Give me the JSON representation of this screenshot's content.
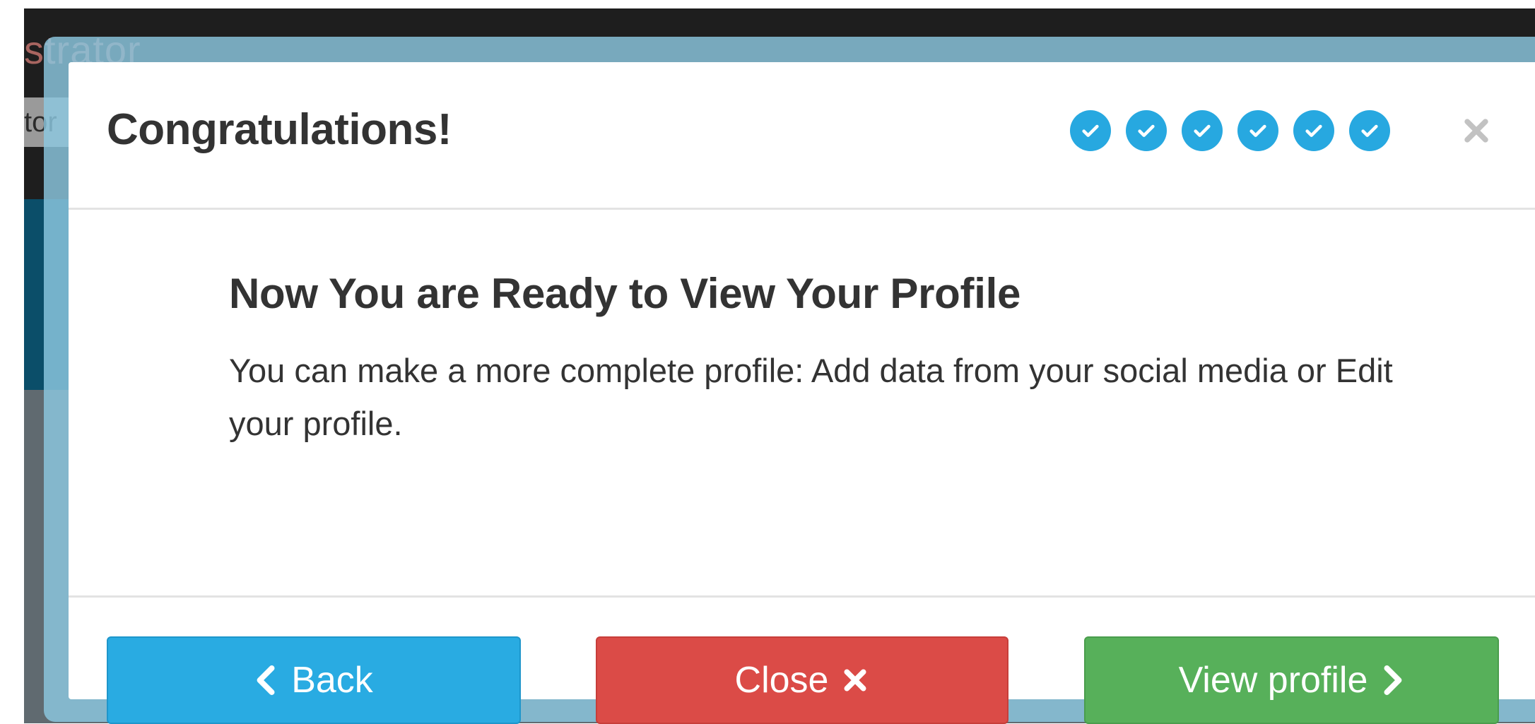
{
  "background": {
    "brand_fragment": "strator",
    "chip_fragment": "tor"
  },
  "modal": {
    "title": "Congratulations!",
    "steps": [
      {
        "icon": "check-circle-icon",
        "state": "complete"
      },
      {
        "icon": "check-circle-icon",
        "state": "complete"
      },
      {
        "icon": "check-circle-icon",
        "state": "complete"
      },
      {
        "icon": "check-circle-icon",
        "state": "complete"
      },
      {
        "icon": "check-circle-icon",
        "state": "complete"
      },
      {
        "icon": "check-circle-icon",
        "state": "complete"
      }
    ],
    "close_icon": "close-icon",
    "heading": "Now You are Ready to View Your Profile",
    "message": "You can make a more complete profile: Add data from your social media or Edit your profile.",
    "buttons": {
      "back": "Back",
      "close": "Close",
      "view_profile": "View profile"
    }
  },
  "colors": {
    "step_accent": "#27a8e0",
    "back_button": "#29abe2",
    "close_button": "#db4b47",
    "view_button": "#57b05a",
    "modal_frame": "#8cc8e1"
  }
}
